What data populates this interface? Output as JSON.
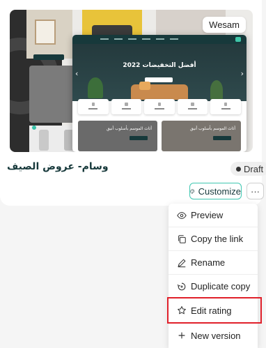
{
  "template": {
    "author_badge": "Wesam",
    "name": "وسام- عروض الصيف",
    "status": "Draft",
    "preview_site": {
      "hero_title": "أفضل التخفيضات 2022",
      "card_1_text": "أثاث الموسم بأسلوب أنيق",
      "card_2_text": "أثاث الموسم بأسلوب أنيق"
    }
  },
  "actions": {
    "customize_label": "Customize",
    "more_label": "···"
  },
  "menu": {
    "items": [
      {
        "label": "Preview",
        "icon": "eye-icon"
      },
      {
        "label": "Copy the link",
        "icon": "copy-icon"
      },
      {
        "label": "Rename",
        "icon": "pencil-icon"
      },
      {
        "label": "Duplicate copy",
        "icon": "duplicate-icon"
      },
      {
        "label": "Edit rating",
        "icon": "star-icon"
      },
      {
        "label": "New version",
        "icon": "plus-icon"
      }
    ]
  },
  "colors": {
    "accent": "#3ec7b1",
    "brand_dark": "#17393b",
    "highlight": "#e0202a"
  }
}
